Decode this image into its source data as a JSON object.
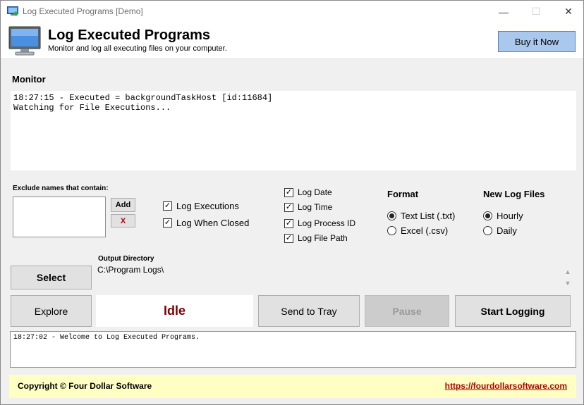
{
  "window": {
    "title": "Log Executed Programs [Demo]"
  },
  "titlebar": {
    "minimize": "—",
    "maximize": "☐",
    "close": "✕"
  },
  "header": {
    "title": "Log Executed Programs",
    "subtitle": "Monitor and log all executing files on your computer.",
    "buy_label": "Buy it Now"
  },
  "monitor": {
    "label": "Monitor",
    "lines": [
      "18:27:15 - Executed = backgroundTaskHost [id:11684]",
      "Watching for File Executions..."
    ]
  },
  "exclude": {
    "label": "Exclude names that contain:",
    "value": "",
    "add_label": "Add",
    "remove_label": "X"
  },
  "log_options": [
    {
      "label": "Log Executions",
      "checked": true
    },
    {
      "label": "Log When Closed",
      "checked": true
    }
  ],
  "details": [
    {
      "label": "Log Date",
      "checked": true
    },
    {
      "label": "Log Time",
      "checked": true
    },
    {
      "label": "Log Process ID",
      "checked": true
    },
    {
      "label": "Log File Path",
      "checked": true
    }
  ],
  "format": {
    "title": "Format",
    "options": [
      {
        "label": "Text List (.txt)",
        "selected": true
      },
      {
        "label": "Excel (.csv)",
        "selected": false
      }
    ]
  },
  "new_log": {
    "title": "New Log Files",
    "options": [
      {
        "label": "Hourly",
        "selected": true
      },
      {
        "label": "Daily",
        "selected": false
      }
    ]
  },
  "output": {
    "label": "Output Directory",
    "path": "C:\\Program Logs\\"
  },
  "buttons": {
    "select": "Select",
    "explore": "Explore",
    "send_to_tray": "Send to Tray",
    "pause": "Pause",
    "start": "Start Logging"
  },
  "status": {
    "text": "Idle",
    "color": "#7b0000"
  },
  "log": {
    "line": "18:27:02 - Welcome to Log Executed Programs."
  },
  "footer": {
    "copyright": "Copyright © Four Dollar Software",
    "link": "https://fourdollarsoftware.com"
  },
  "colors": {
    "buy_button": "#aac7ee",
    "footer_bg": "#ffffc4",
    "link": "#b00000"
  }
}
